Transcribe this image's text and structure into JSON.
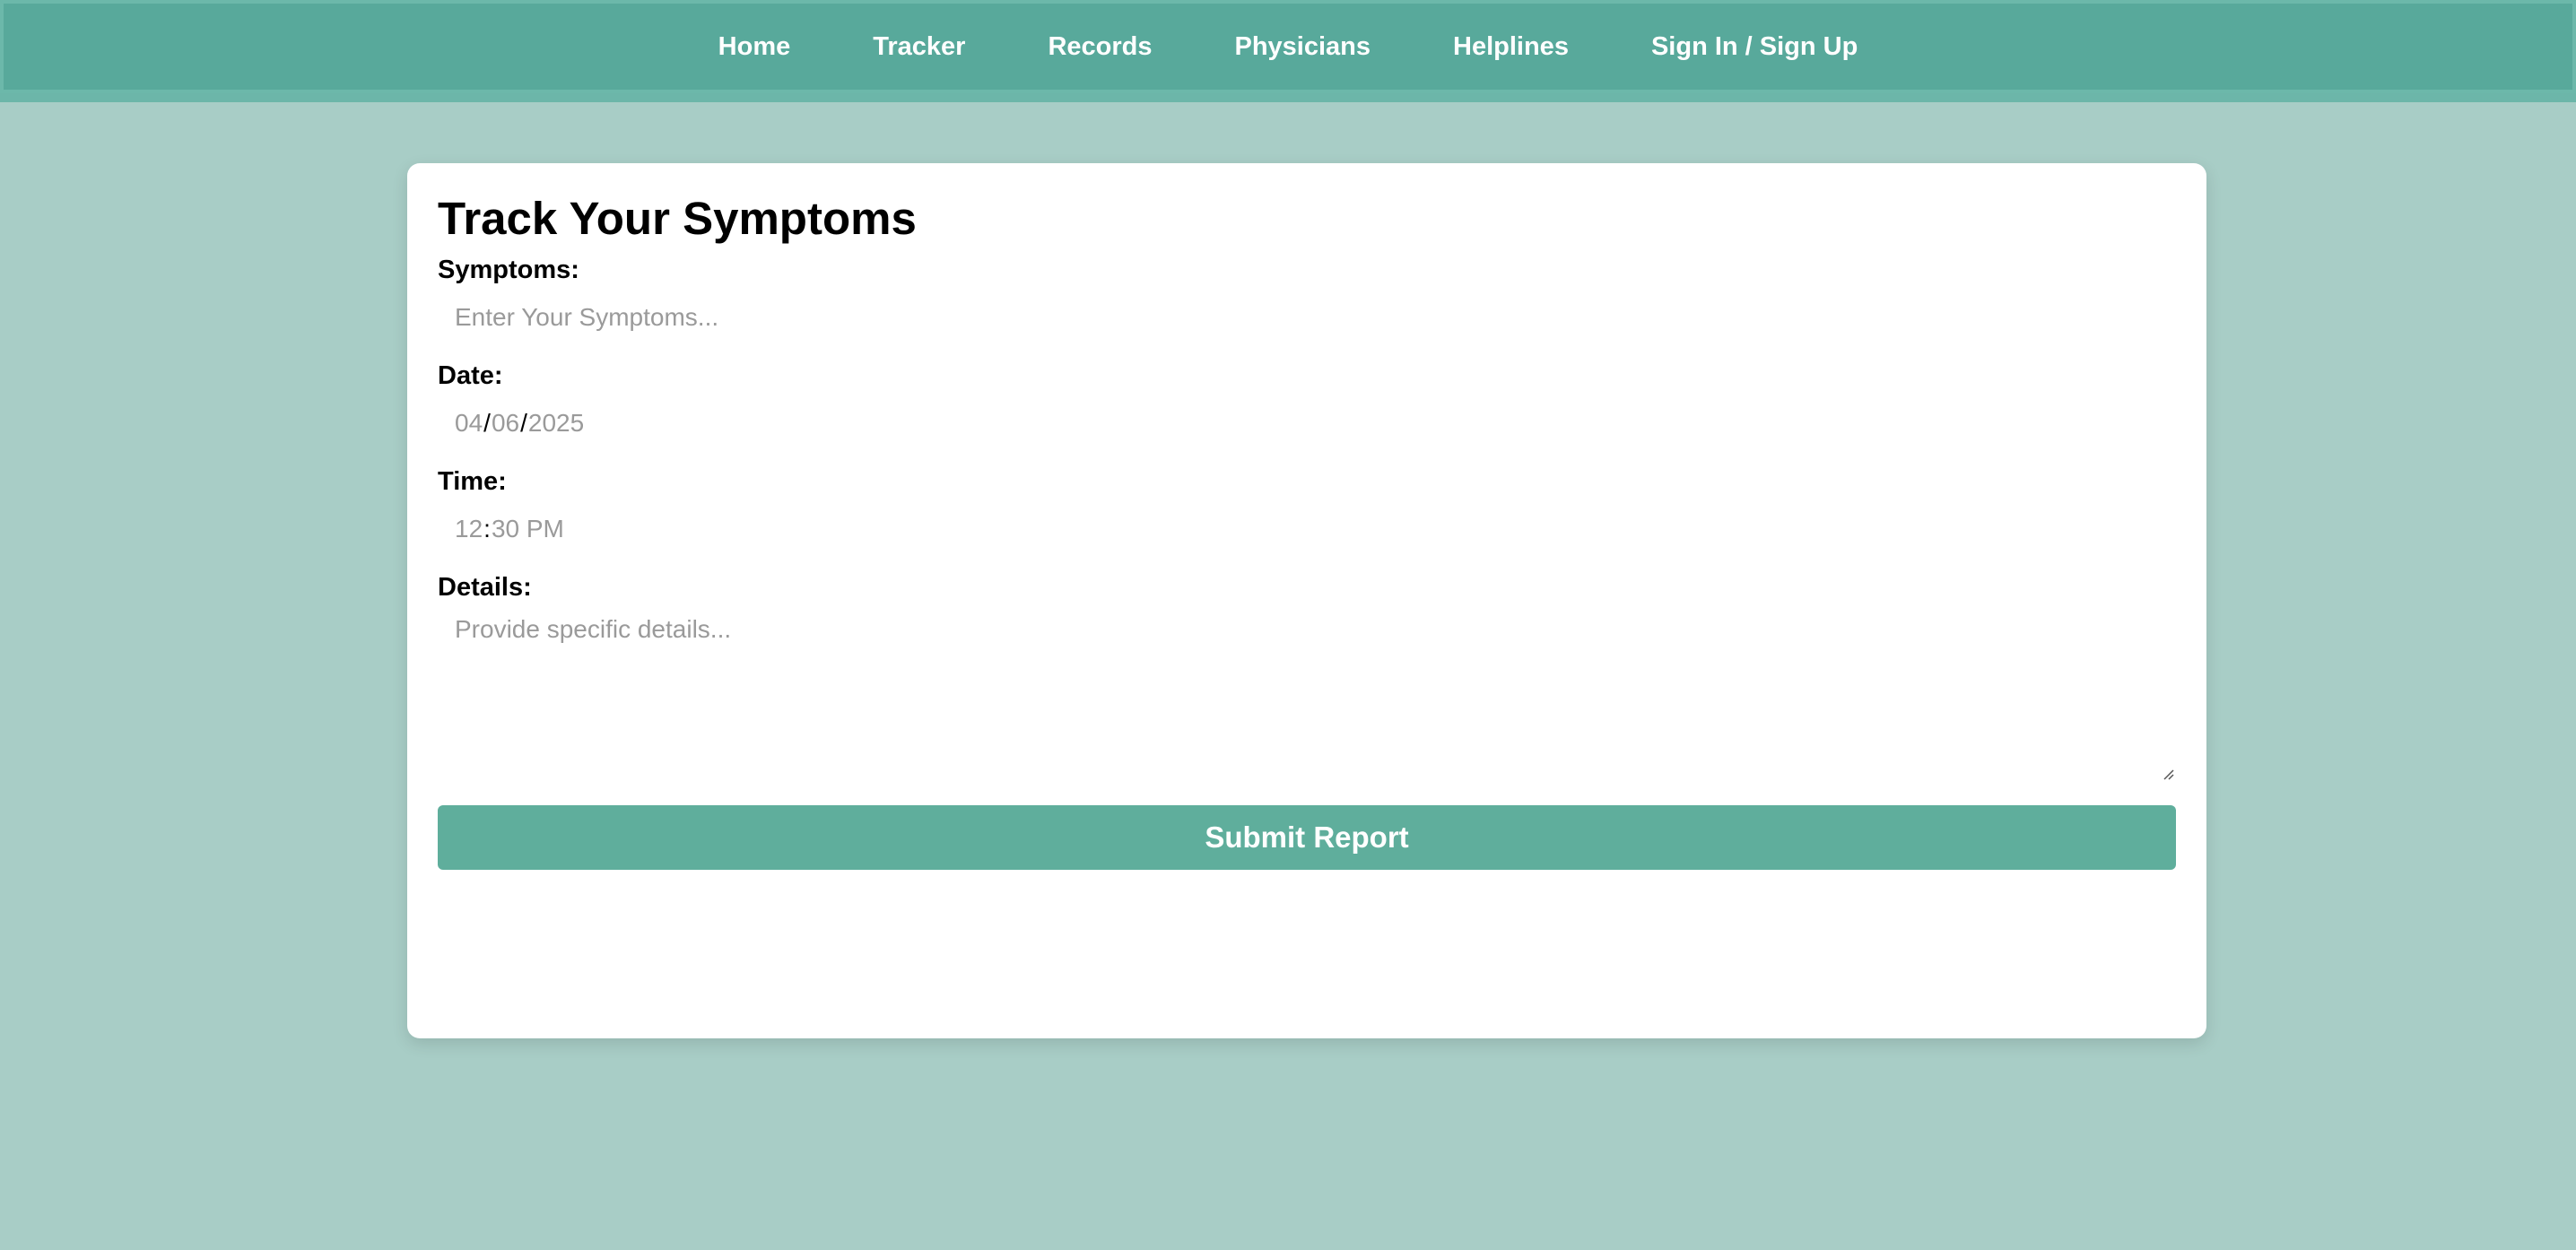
{
  "nav": {
    "items": [
      {
        "label": "Home"
      },
      {
        "label": "Tracker"
      },
      {
        "label": "Records"
      },
      {
        "label": "Physicians"
      },
      {
        "label": "Helplines"
      },
      {
        "label": "Sign In / Sign Up"
      }
    ]
  },
  "form": {
    "title": "Track Your Symptoms",
    "symptoms_label": "Symptoms:",
    "symptoms_placeholder": "Enter Your Symptoms...",
    "date_label": "Date:",
    "date_month": "04",
    "date_day": "06",
    "date_year": "2025",
    "date_separator": "/",
    "time_label": "Time:",
    "time_hour": "12",
    "time_separator": ":",
    "time_rest": "30 PM",
    "details_label": "Details:",
    "details_placeholder": "Provide specific details...",
    "submit_label": "Submit Report"
  },
  "colors": {
    "background": "#a8cdc6",
    "navbar": "#58a99b",
    "accent": "#5fae9c"
  }
}
